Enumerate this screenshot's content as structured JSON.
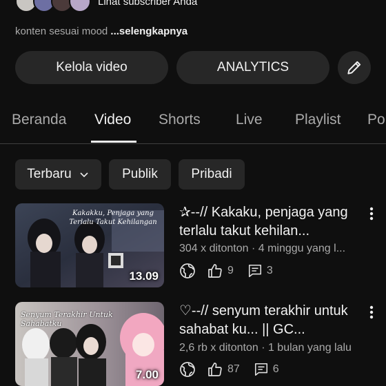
{
  "channel": {
    "subscribers_link": "Lihat subscriber Anda",
    "description_text": "konten sesuai mood ",
    "description_more": "...selengkapnya"
  },
  "actions": {
    "manage_videos": "Kelola video",
    "analytics": "ANALYTICS",
    "edit_icon": "pencil-icon"
  },
  "tabs": [
    {
      "label": "Beranda",
      "active": false
    },
    {
      "label": "Video",
      "active": true
    },
    {
      "label": "Shorts",
      "active": false
    },
    {
      "label": "Live",
      "active": false
    },
    {
      "label": "Playlist",
      "active": false
    },
    {
      "label": "Po",
      "active": false
    }
  ],
  "filters": {
    "sort": "Terbaru",
    "public": "Publik",
    "private": "Pribadi"
  },
  "videos": [
    {
      "title": "✰--// Kakaku, penjaga yang terlalu takut kehilan...",
      "meta": "304 x ditonton · 4 minggu yang l...",
      "duration": "13.09",
      "thumb_text": "Kakakku, Penjaga yang Terlalu Takut Kehilangan",
      "likes": "9",
      "comments": "3",
      "visibility_icon": "globe-icon"
    },
    {
      "title": "♡--// senyum terakhir untuk sahabat ku... || GC...",
      "meta": "2,6 rb x ditonton · 1 bulan yang lalu",
      "duration": "7.00",
      "thumb_text": "Senyum Terakhir Untuk Sahabatku",
      "likes": "87",
      "comments": "6",
      "visibility_icon": "globe-icon"
    }
  ],
  "colors": {
    "background": "#0f0f0f",
    "surface": "#272727",
    "text_primary": "#f1f1f1",
    "text_secondary": "#aaaaaa"
  }
}
